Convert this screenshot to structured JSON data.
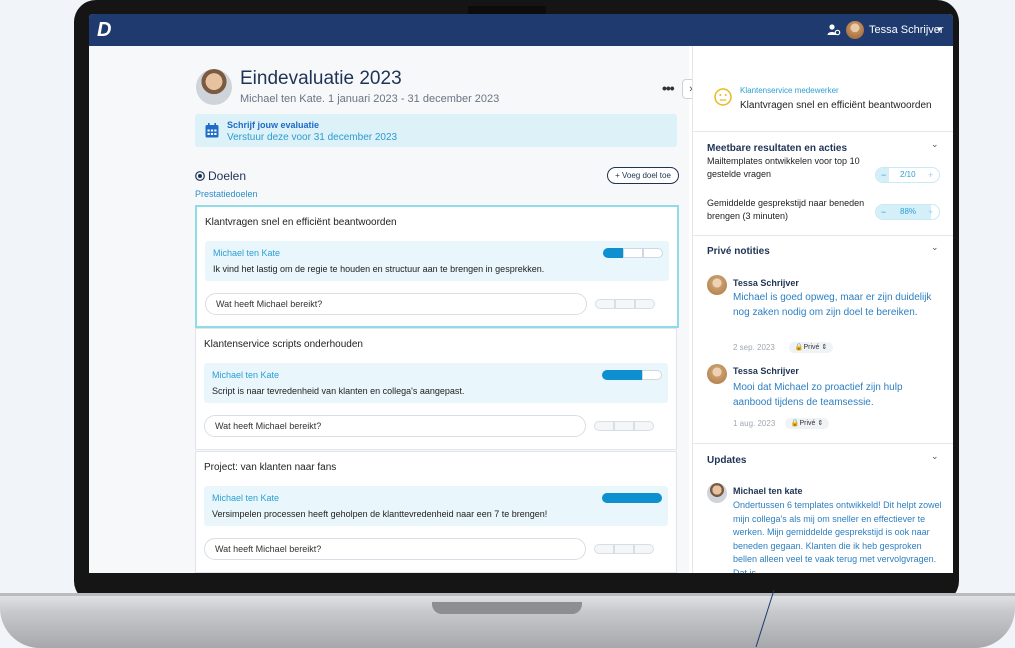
{
  "app": {
    "logo": "D",
    "user_name": "Tessa Schrijver",
    "caret": "▾"
  },
  "evaluation": {
    "title": "Eindevaluatie 2023",
    "subtitle": "Michael ten Kate. 1 januari 2023 - 31 december 2023",
    "more": "•••",
    "panel_toggle": "›"
  },
  "notice": {
    "title": "Schrijf jouw evaluatie",
    "subtitle": "Verstuur deze voor 31 december 2023"
  },
  "goals": {
    "title": "Doelen",
    "add_label": "+ Voeg doel toe",
    "section": "Prestatiedoelen",
    "items": [
      {
        "title": "Klantvragen snel en efficiënt beantwoorden",
        "author": "Michael ten Kate",
        "comment": "Ik vind het lastig om de regie te houden en structuur aan te brengen in gesprekken.",
        "progress_segments": 1,
        "reply_placeholder": "Wat heeft Michael bereikt?"
      },
      {
        "title": "Klantenservice scripts onderhouden",
        "author": "Michael ten Kate",
        "comment": "Script is naar tevredenheid van klanten en collega's aangepast.",
        "progress_segments": 2,
        "reply_placeholder": "Wat heeft Michael bereikt?"
      },
      {
        "title": "Project: van klanten naar fans",
        "author": "Michael ten Kate",
        "comment": "Versimpelen processen heeft geholpen de klanttevredenheid naar een 7 te brengen!",
        "progress_segments": 3,
        "reply_placeholder": "Wat heeft Michael bereikt?"
      }
    ]
  },
  "sidebar": {
    "role": "Klantenservice medewerker",
    "goal": "Klantvragen snel en efficiënt beantwoorden",
    "results": {
      "title": "Meetbare resultaten en acties",
      "items": [
        {
          "label": "Mailtemplates ontwikkelen voor top 10 gestelde vragen",
          "value": "2/10",
          "fraction": 0.2,
          "minus": "−",
          "plus": "+"
        },
        {
          "label": "Gemiddelde gesprekstijd naar beneden brengen (3 minuten)",
          "value": "88%",
          "fraction": 0.88,
          "minus": "−",
          "plus": "+"
        }
      ]
    },
    "notes": {
      "title": "Privé notities",
      "items": [
        {
          "author": "Tessa Schrijver",
          "text": "Michael is goed opweg, maar er zijn duidelijk nog zaken nodig om zijn doel te bereiken.",
          "date": "2 sep. 2023",
          "privacy": "🔒Privé ⇕"
        },
        {
          "author": "Tessa Schrijver",
          "text": "Mooi dat Michael zo proactief zijn hulp aanbood tijdens de teamsessie.",
          "date": "1 aug. 2023",
          "privacy": "🔒Privé ⇕"
        }
      ]
    },
    "updates": {
      "title": "Updates",
      "author": "Michael ten kate",
      "text": "Ondertussen 6 templates ontwikkeld! Dit helpt zowel mijn collega's als mij om sneller en effectiever te werken. Mijn gemiddelde gesprekstijd is ook naar beneden gegaan. Klanten die ik heb gesproken bellen alleen veel te vaak terug met vervolgvragen. Dat is"
    },
    "chevron": "⌄"
  },
  "colors": {
    "header": "#1e3a6e",
    "accent": "#0d8fd0",
    "link": "#2b9fd4"
  }
}
